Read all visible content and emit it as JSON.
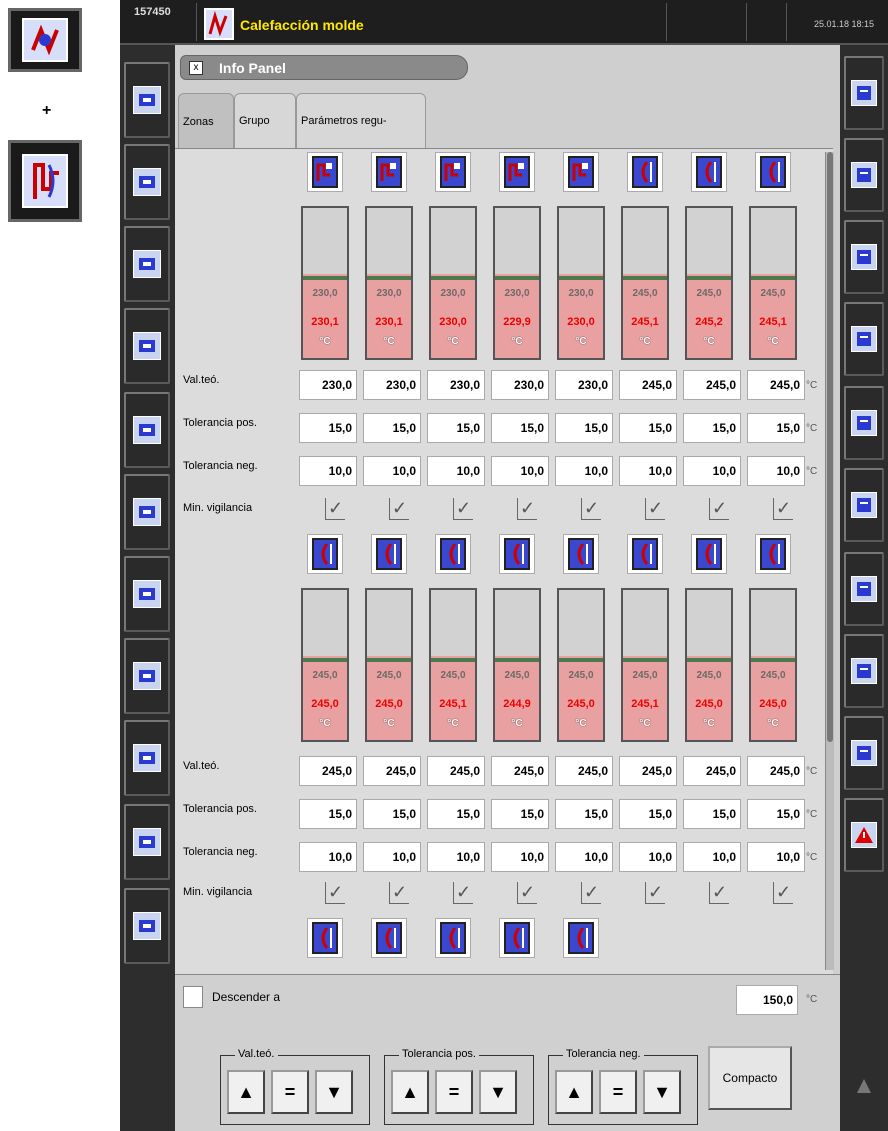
{
  "top": {
    "id": "157450",
    "title": "Calefacción molde",
    "time": "25.01.18 18:15"
  },
  "legend": {
    "plus": "+"
  },
  "info_panel": {
    "title": "Info Panel",
    "close": "x"
  },
  "tabs": [
    "Zonas",
    "Grupo",
    "Parámetros regu-"
  ],
  "labels": {
    "setpoint": "Val.teó.",
    "tol_pos": "Tolerancia pos.",
    "tol_neg": "Tolerancia neg.",
    "min_vig": "Min. vigilancia"
  },
  "unit": "°C",
  "check_mark": "✓",
  "group1": {
    "setpoints_bar": [
      "230,0",
      "230,0",
      "230,0",
      "230,0",
      "230,0",
      "245,0",
      "245,0",
      "245,0"
    ],
    "actuals": [
      "230,1",
      "230,1",
      "230,0",
      "229,9",
      "230,0",
      "245,1",
      "245,2",
      "245,1"
    ],
    "setpoint": [
      "230,0",
      "230,0",
      "230,0",
      "230,0",
      "230,0",
      "245,0",
      "245,0",
      "245,0"
    ],
    "tol_pos": [
      "15,0",
      "15,0",
      "15,0",
      "15,0",
      "15,0",
      "15,0",
      "15,0",
      "15,0"
    ],
    "tol_neg": [
      "10,0",
      "10,0",
      "10,0",
      "10,0",
      "10,0",
      "10,0",
      "10,0",
      "10,0"
    ]
  },
  "group2": {
    "setpoints_bar": [
      "245,0",
      "245,0",
      "245,0",
      "245,0",
      "245,0",
      "245,0",
      "245,0",
      "245,0"
    ],
    "actuals": [
      "245,0",
      "245,0",
      "245,1",
      "244,9",
      "245,0",
      "245,1",
      "245,0",
      "245,0"
    ],
    "setpoint": [
      "245,0",
      "245,0",
      "245,0",
      "245,0",
      "245,0",
      "245,0",
      "245,0",
      "245,0"
    ],
    "tol_pos": [
      "15,0",
      "15,0",
      "15,0",
      "15,0",
      "15,0",
      "15,0",
      "15,0",
      "15,0"
    ],
    "tol_neg": [
      "10,0",
      "10,0",
      "10,0",
      "10,0",
      "10,0",
      "10,0",
      "10,0",
      "10,0"
    ]
  },
  "bottom": {
    "lower_label": "Descender a",
    "lower_value": "150,0",
    "groups": [
      "Val.teó.",
      "Tolerancia pos.",
      "Tolerancia neg."
    ],
    "btn_up": "▲",
    "btn_eq": "=",
    "btn_down": "▼",
    "compact": "Compacto",
    "scroll_up": "▲"
  },
  "left_nav_icons": [
    "screen-icon",
    "mold-open-icon",
    "mold-close-icon",
    "injection-icon",
    "ejector-icon",
    "nozzle-icon",
    "dosing-icon",
    "cooling-icon",
    "heating-icon",
    "temperature-icon",
    "graph-icon"
  ],
  "right_nav_icons": [
    "back-icon",
    "process-icon",
    "setup-icon",
    "overview-icon",
    "printer-icon",
    "edit-icon",
    "note-icon",
    "tools-icon",
    "help-icon",
    "alarm-icon"
  ]
}
